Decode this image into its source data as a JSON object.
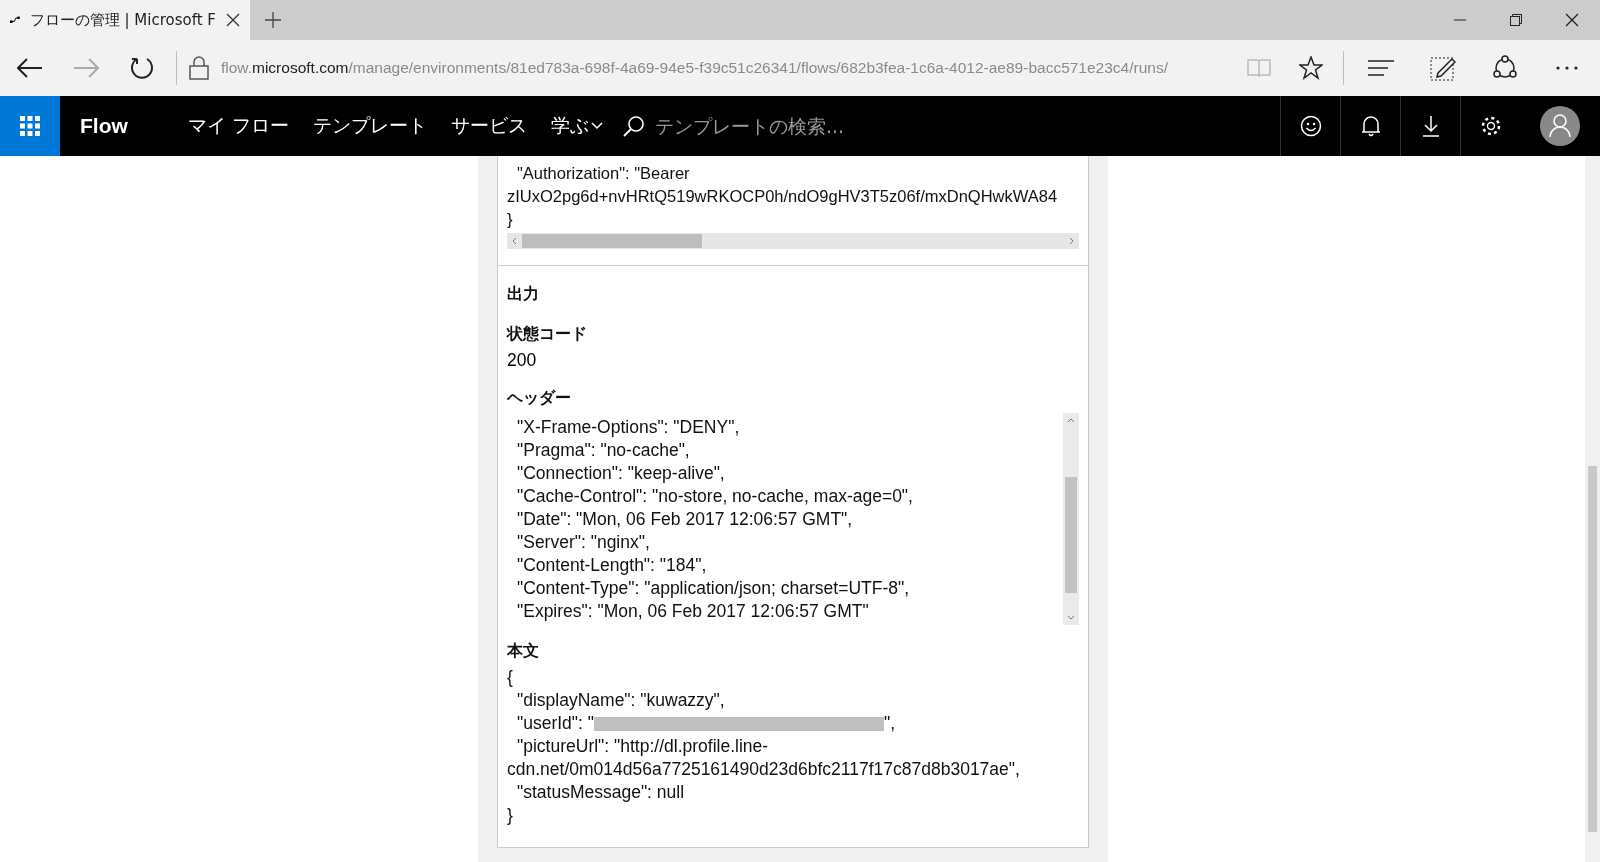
{
  "browser": {
    "tab_title": "フローの管理 | Microsoft F",
    "url": {
      "subdomain": "flow.",
      "domain": "microsoft.com",
      "path": "/manage/environments/81ed783a-698f-4a69-94e5-f39c51c26341/flows/682b3fea-1c6a-4012-ae89-bacc571e23c4/runs/"
    }
  },
  "app": {
    "name": "Flow",
    "nav": [
      {
        "label": "マイ フロー",
        "dropdown": false
      },
      {
        "label": "テンプレート",
        "dropdown": false
      },
      {
        "label": "サービス",
        "dropdown": false
      },
      {
        "label": "学ぶ",
        "dropdown": true
      }
    ],
    "search": {
      "placeholder": "テンプレートの検索..."
    }
  },
  "request": {
    "lines": [
      {
        "text": "\"Authorization\": \"Bearer",
        "indent": true
      },
      {
        "text": "zIUxO2pg6d+nvHRtQ519wRKOCP0h/ndO9gHV3T5z06f/mxDnQHwkWA84",
        "indent": false
      },
      {
        "text": "}",
        "indent": false
      }
    ]
  },
  "output": {
    "title": "出力",
    "status": {
      "label": "状態コード",
      "value": "200"
    },
    "headers": {
      "label": "ヘッダー",
      "lines": [
        {
          "text": "\"X-Frame-Options\": \"DENY\",",
          "indent": true
        },
        {
          "text": "\"Pragma\": \"no-cache\",",
          "indent": true
        },
        {
          "text": "\"Connection\": \"keep-alive\",",
          "indent": true
        },
        {
          "text": "\"Cache-Control\": \"no-store, no-cache, max-age=0\",",
          "indent": true
        },
        {
          "text": "\"Date\": \"Mon, 06 Feb 2017 12:06:57 GMT\",",
          "indent": true
        },
        {
          "text": "\"Server\": \"nginx\",",
          "indent": true
        },
        {
          "text": "\"Content-Length\": \"184\",",
          "indent": true
        },
        {
          "text": "\"Content-Type\": \"application/json; charset=UTF-8\",",
          "indent": true
        },
        {
          "text": "\"Expires\": \"Mon, 06 Feb 2017 12:06:57 GMT\"",
          "indent": true
        }
      ]
    },
    "body": {
      "label": "本文",
      "lines": [
        {
          "kind": "text",
          "text": "{",
          "indent": false
        },
        {
          "kind": "text",
          "text": "\"displayName\": \"kuwazzy\",",
          "indent": true
        },
        {
          "kind": "redacted",
          "before": "\"userId\": \"",
          "after": "\",",
          "indent": true
        },
        {
          "kind": "text",
          "text": "\"pictureUrl\": \"http://dl.profile.line-",
          "indent": true
        },
        {
          "kind": "text",
          "text": "cdn.net/0m014d56a7725161490d23d6bfc2117f17c87d8b3017ae\",",
          "indent": false
        },
        {
          "kind": "text",
          "text": "\"statusMessage\": null",
          "indent": true
        },
        {
          "kind": "text",
          "text": "}",
          "indent": false
        }
      ]
    }
  }
}
